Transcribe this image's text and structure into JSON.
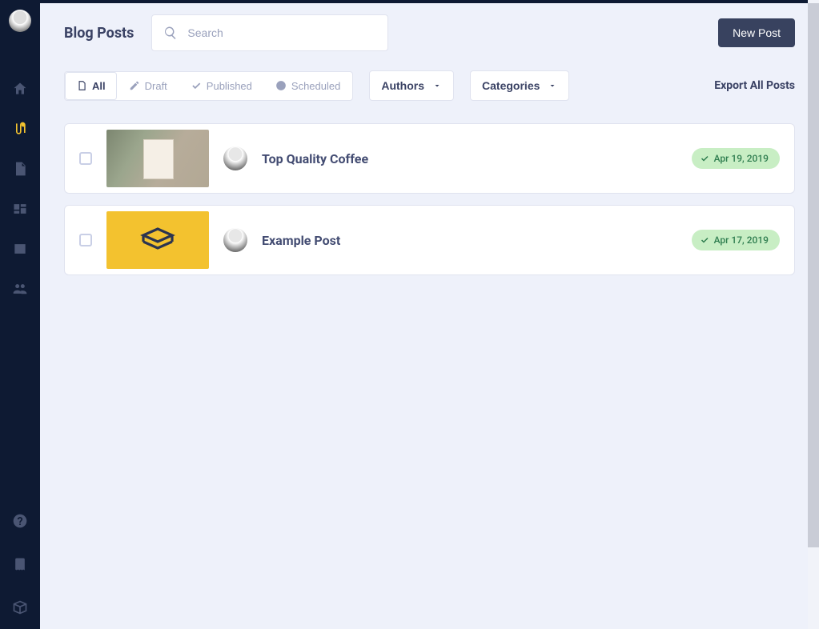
{
  "page": {
    "title": "Blog Posts"
  },
  "header": {
    "search_placeholder": "Search",
    "new_post_label": "New Post"
  },
  "filters": {
    "all": "All",
    "draft": "Draft",
    "published": "Published",
    "scheduled": "Scheduled"
  },
  "dropdowns": {
    "authors": "Authors",
    "categories": "Categories"
  },
  "actions": {
    "export": "Export All Posts"
  },
  "posts": [
    {
      "title": "Top Quality Coffee",
      "date": "Apr 19, 2019",
      "status": "published",
      "thumb": "coffee"
    },
    {
      "title": "Example Post",
      "date": "Apr 17, 2019",
      "status": "published",
      "thumb": "placeholder"
    }
  ],
  "sidebar": {
    "icons": [
      "home",
      "blog",
      "pages",
      "items",
      "media",
      "users"
    ],
    "bottom_icons": [
      "help",
      "book",
      "box"
    ]
  }
}
